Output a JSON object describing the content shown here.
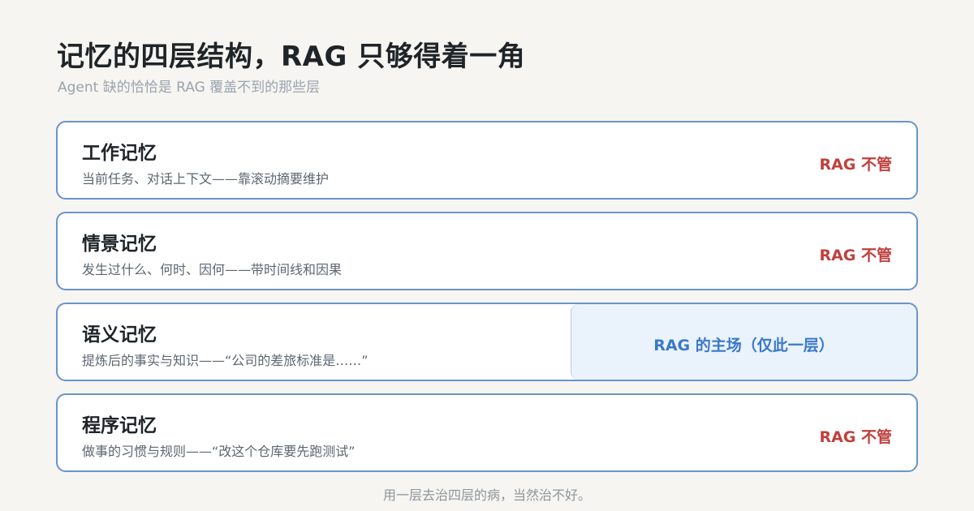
{
  "header": {
    "title": "记忆的四层结构，RAG 只够得着一角",
    "subtitle": "Agent 缺的恰恰是 RAG 覆盖不到的那些层"
  },
  "layers": [
    {
      "name": "工作记忆",
      "desc": "当前任务、对话上下文——靠滚动摘要维护",
      "rag": "RAG 不管"
    },
    {
      "name": "情景记忆",
      "desc": "发生过什么、何时、因何——带时间线和因果",
      "rag": "RAG 不管"
    },
    {
      "name": "语义记忆",
      "desc": "提炼后的事实与知识——“公司的差旅标准是……”",
      "rag": "RAG 的主场（仅此一层）"
    },
    {
      "name": "程序记忆",
      "desc": "做事的习惯与规则——“改这个仓库要先跑测试”",
      "rag": "RAG 不管"
    }
  ],
  "footer": "用一层去治四层的病，当然治不好。",
  "colors": {
    "background": "#f6f5f1",
    "card_border": "#6a93cc",
    "not_covered": "#c0403c",
    "covered": "#3a79c8",
    "covered_fill": "#eaf2fb"
  }
}
